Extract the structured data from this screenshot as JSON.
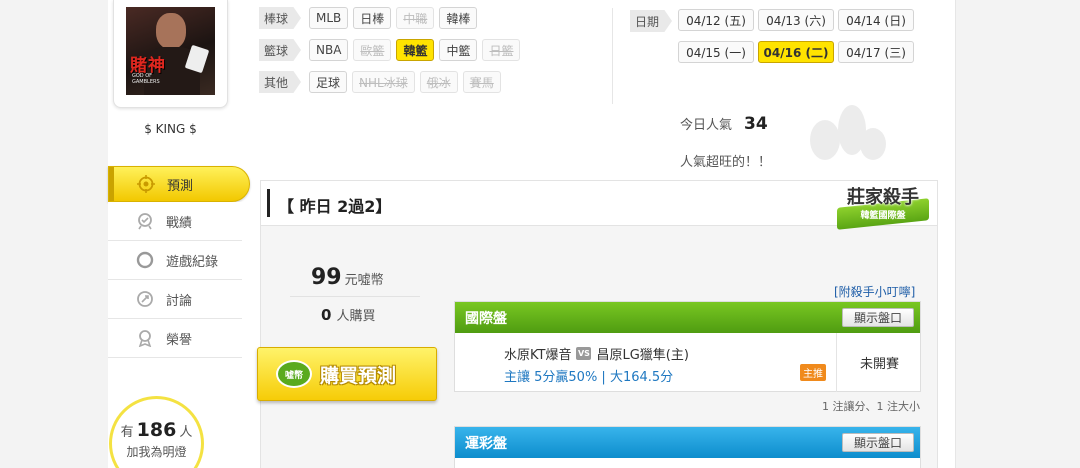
{
  "user": {
    "name": "$ KING $",
    "avatar_title": "賭神",
    "avatar_subtitle": "GOD OF GAMBLERS"
  },
  "nav": {
    "items": [
      {
        "label": "預測",
        "icon": "target-icon",
        "active": true
      },
      {
        "label": "戰績",
        "icon": "trophy-icon",
        "active": false
      },
      {
        "label": "遊戲紀錄",
        "icon": "ring-icon",
        "active": false
      },
      {
        "label": "討論",
        "icon": "chat-icon",
        "active": false
      },
      {
        "label": "榮譽",
        "icon": "medal-icon",
        "active": false
      }
    ]
  },
  "fans": {
    "prefix": "有",
    "count": "186",
    "suffix": "人",
    "join": "加我為明燈"
  },
  "filters": {
    "rows": [
      {
        "label": "棒球",
        "chips": [
          {
            "text": "MLB",
            "state": "normal"
          },
          {
            "text": "日棒",
            "state": "normal"
          },
          {
            "text": "中職",
            "state": "disabled"
          },
          {
            "text": "韓棒",
            "state": "normal"
          }
        ]
      },
      {
        "label": "籃球",
        "chips": [
          {
            "text": "NBA",
            "state": "normal"
          },
          {
            "text": "歐籃",
            "state": "disabled"
          },
          {
            "text": "韓籃",
            "state": "selected"
          },
          {
            "text": "中籃",
            "state": "normal"
          },
          {
            "text": "日籃",
            "state": "disabled"
          }
        ]
      },
      {
        "label": "其他",
        "chips": [
          {
            "text": "足球",
            "state": "normal"
          },
          {
            "text": "NHL冰球",
            "state": "disabled"
          },
          {
            "text": "俄冰",
            "state": "disabled"
          },
          {
            "text": "賽馬",
            "state": "disabled"
          }
        ]
      }
    ]
  },
  "dates": {
    "label": "日期",
    "items": [
      {
        "text": "04/12 (五)",
        "selected": false
      },
      {
        "text": "04/13 (六)",
        "selected": false
      },
      {
        "text": "04/14 (日)",
        "selected": false
      },
      {
        "text": "04/15 (一)",
        "selected": false
      },
      {
        "text": "04/16 (二)",
        "selected": true
      },
      {
        "text": "04/17 (三)",
        "selected": false
      }
    ]
  },
  "popularity": {
    "label": "今日人氣",
    "value": "34",
    "comment": "人氣超旺的！！"
  },
  "panel": {
    "title": "【 昨日 2過2】",
    "badge_title": "莊家殺手",
    "badge_sub": "韓籃國際盤"
  },
  "purchase": {
    "price": "99",
    "price_unit": "元噓幣",
    "buyers": "0",
    "buyers_unit": "人購買",
    "buy_label": "購買預測",
    "coin_label": "噓幣"
  },
  "tips_link": "[附殺手小叮嚀]",
  "sections": {
    "intl": {
      "title": "國際盤",
      "show": "顯示盤口",
      "home": "水原KT爆音",
      "vs": "VS",
      "away": "昌原LG獵隼(主)",
      "odds": "主讓 5分贏50% | 大164.5分",
      "host_badge": "主推",
      "status": "未開賽"
    },
    "lottery": {
      "title": "運彩盤",
      "show": "顯示盤口"
    }
  },
  "note": "1 注讓分、1 注大小"
}
